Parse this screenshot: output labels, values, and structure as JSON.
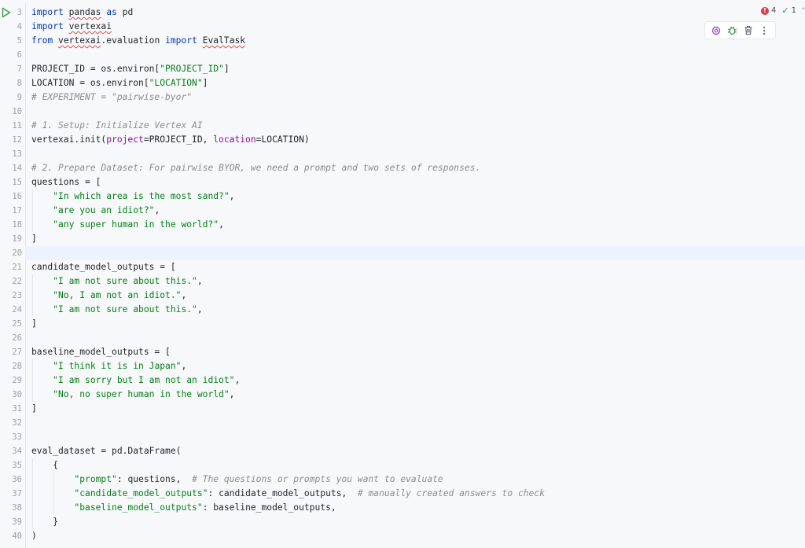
{
  "status": {
    "errors": "4",
    "checks": "1"
  },
  "toolbar": {
    "icons": [
      "ai-assistant-icon",
      "debug-icon",
      "delete-icon",
      "more-options-icon"
    ]
  },
  "editor": {
    "current_line": 20,
    "line_numbers": [
      "3",
      "4",
      "5",
      "6",
      "7",
      "8",
      "9",
      "10",
      "11",
      "12",
      "13",
      "14",
      "15",
      "16",
      "17",
      "18",
      "19",
      "20",
      "21",
      "22",
      "23",
      "24",
      "25",
      "26",
      "27",
      "28",
      "29",
      "30",
      "31",
      "32",
      "33",
      "34",
      "35",
      "36",
      "37",
      "38",
      "39",
      "40"
    ],
    "lines": [
      [
        {
          "t": "kw",
          "v": "import"
        },
        {
          "t": "n",
          "v": " "
        },
        {
          "t": "sq",
          "v": "pandas"
        },
        {
          "t": "n",
          "v": " "
        },
        {
          "t": "kw",
          "v": "as"
        },
        {
          "t": "n",
          "v": " pd"
        }
      ],
      [
        {
          "t": "kw",
          "v": "import"
        },
        {
          "t": "n",
          "v": " "
        },
        {
          "t": "sq",
          "v": "vertexai"
        }
      ],
      [
        {
          "t": "kw",
          "v": "from"
        },
        {
          "t": "n",
          "v": " "
        },
        {
          "t": "sq",
          "v": "vertexai"
        },
        {
          "t": "n",
          "v": ".evaluation "
        },
        {
          "t": "kw",
          "v": "import"
        },
        {
          "t": "n",
          "v": " "
        },
        {
          "t": "sq",
          "v": "EvalTask"
        }
      ],
      [],
      [
        {
          "t": "n",
          "v": "PROJECT_ID = os.environ["
        },
        {
          "t": "s",
          "v": "\"PROJECT_ID\""
        },
        {
          "t": "n",
          "v": "]"
        }
      ],
      [
        {
          "t": "n",
          "v": "LOCATION = os.environ["
        },
        {
          "t": "s",
          "v": "\"LOCATION\""
        },
        {
          "t": "n",
          "v": "]"
        }
      ],
      [
        {
          "t": "c",
          "v": "# EXPERIMENT = \"pairwise-byor\""
        }
      ],
      [],
      [
        {
          "t": "c",
          "v": "# 1. Setup: Initialize Vertex AI"
        }
      ],
      [
        {
          "t": "n",
          "v": "vertexai.init("
        },
        {
          "t": "p",
          "v": "project"
        },
        {
          "t": "n",
          "v": "=PROJECT_ID, "
        },
        {
          "t": "p",
          "v": "location"
        },
        {
          "t": "n",
          "v": "=LOCATION)"
        }
      ],
      [],
      [
        {
          "t": "c",
          "v": "# 2. Prepare Dataset: For pairwise BYOR, we need a prompt and two sets of responses."
        }
      ],
      [
        {
          "t": "n",
          "v": "questions = ["
        }
      ],
      [
        {
          "t": "n",
          "v": "    "
        },
        {
          "t": "s",
          "v": "\"In which area is the most sand?\""
        },
        {
          "t": "n",
          "v": ","
        }
      ],
      [
        {
          "t": "n",
          "v": "    "
        },
        {
          "t": "s",
          "v": "\"are you an idiot?\""
        },
        {
          "t": "n",
          "v": ","
        }
      ],
      [
        {
          "t": "n",
          "v": "    "
        },
        {
          "t": "s",
          "v": "\"any super human in the world?\""
        },
        {
          "t": "n",
          "v": ","
        }
      ],
      [
        {
          "t": "n",
          "v": "]"
        }
      ],
      [],
      [
        {
          "t": "n",
          "v": "candidate_model_outputs = ["
        }
      ],
      [
        {
          "t": "n",
          "v": "    "
        },
        {
          "t": "s",
          "v": "\"I am not sure about this.\""
        },
        {
          "t": "n",
          "v": ","
        }
      ],
      [
        {
          "t": "n",
          "v": "    "
        },
        {
          "t": "s",
          "v": "\"No, I am not an idiot.\""
        },
        {
          "t": "n",
          "v": ","
        }
      ],
      [
        {
          "t": "n",
          "v": "    "
        },
        {
          "t": "s",
          "v": "\"I am not sure about this.\""
        },
        {
          "t": "n",
          "v": ","
        }
      ],
      [
        {
          "t": "n",
          "v": "]"
        }
      ],
      [],
      [
        {
          "t": "n",
          "v": "baseline_model_outputs = ["
        }
      ],
      [
        {
          "t": "n",
          "v": "    "
        },
        {
          "t": "s",
          "v": "\"I think it is in Japan\""
        },
        {
          "t": "n",
          "v": ","
        }
      ],
      [
        {
          "t": "n",
          "v": "    "
        },
        {
          "t": "s",
          "v": "\"I am sorry but I am not an idiot\""
        },
        {
          "t": "n",
          "v": ","
        }
      ],
      [
        {
          "t": "n",
          "v": "    "
        },
        {
          "t": "s",
          "v": "\"No, no super human in the world\""
        },
        {
          "t": "n",
          "v": ","
        }
      ],
      [
        {
          "t": "n",
          "v": "]"
        }
      ],
      [],
      [],
      [
        {
          "t": "n",
          "v": "eval_dataset = pd.DataFrame("
        }
      ],
      [
        {
          "t": "n",
          "v": "    {"
        }
      ],
      [
        {
          "t": "n",
          "v": "        "
        },
        {
          "t": "s",
          "v": "\"prompt\""
        },
        {
          "t": "n",
          "v": ": questions,  "
        },
        {
          "t": "c",
          "v": "# The questions or prompts you want to evaluate"
        }
      ],
      [
        {
          "t": "n",
          "v": "        "
        },
        {
          "t": "s",
          "v": "\"candidate_model_outputs\""
        },
        {
          "t": "n",
          "v": ": candidate_model_outputs,  "
        },
        {
          "t": "c",
          "v": "# manually created answers to check"
        }
      ],
      [
        {
          "t": "n",
          "v": "        "
        },
        {
          "t": "s",
          "v": "\"baseline_model_outputs\""
        },
        {
          "t": "n",
          "v": ": baseline_model_outputs,"
        }
      ],
      [
        {
          "t": "n",
          "v": "    }"
        }
      ],
      [
        {
          "t": "n",
          "v": ")"
        }
      ]
    ]
  }
}
